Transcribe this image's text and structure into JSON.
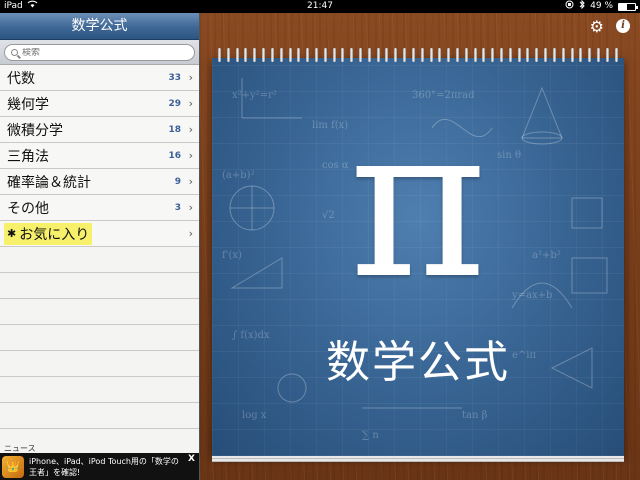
{
  "status_bar": {
    "device": "iPad",
    "time": "21:47",
    "battery": "49 %",
    "battery_level": 0.49
  },
  "sidebar": {
    "title": "数学公式",
    "search_placeholder": "検索",
    "items": [
      {
        "label": "代数",
        "count": "33"
      },
      {
        "label": "幾何学",
        "count": "29"
      },
      {
        "label": "微積分学",
        "count": "18"
      },
      {
        "label": "三角法",
        "count": "16"
      },
      {
        "label": "確率論＆統計",
        "count": "9"
      },
      {
        "label": "その他",
        "count": "3"
      }
    ],
    "favorites_label": "お気に入り",
    "news_label": "ニュース",
    "news_text": "iPhone、iPad、iPod Touch用の「数学の王者」を確認!",
    "news_close": "X"
  },
  "notebook": {
    "symbol": "π",
    "title": "数学公式"
  },
  "icons": {
    "settings": "gear-icon",
    "info": "info-icon",
    "search": "search-icon",
    "favorite": "star-icon"
  },
  "colors": {
    "header_blue": "#3f6896",
    "count_blue": "#3b5f99",
    "highlight": "#f6f06a",
    "notebook_blue": "#3a6796"
  }
}
